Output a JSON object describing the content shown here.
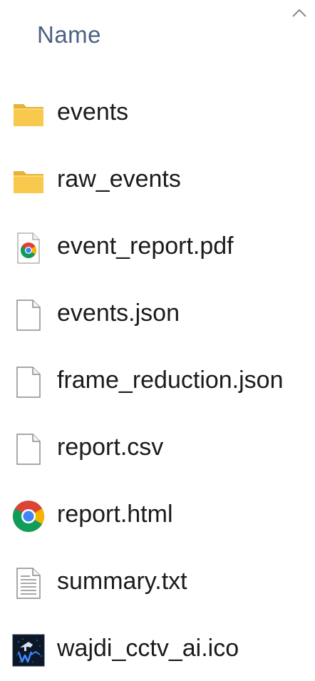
{
  "header": {
    "column_name": "Name",
    "sort_icon": "chevron-up-icon"
  },
  "files": [
    {
      "name": "events",
      "icon": "folder-icon",
      "slug": "events"
    },
    {
      "name": "raw_events",
      "icon": "folder-icon",
      "slug": "raw-events"
    },
    {
      "name": "event_report.pdf",
      "icon": "pdf-chrome-icon",
      "slug": "event-report-pdf"
    },
    {
      "name": "events.json",
      "icon": "generic-file-icon",
      "slug": "events-json"
    },
    {
      "name": "frame_reduction.json",
      "icon": "generic-file-icon",
      "slug": "frame-reduction-json"
    },
    {
      "name": "report.csv",
      "icon": "generic-file-icon",
      "slug": "report-csv"
    },
    {
      "name": "report.html",
      "icon": "chrome-icon",
      "slug": "report-html"
    },
    {
      "name": "summary.txt",
      "icon": "text-file-icon",
      "slug": "summary-txt"
    },
    {
      "name": "wajdi_cctv_ai.ico",
      "icon": "ico-image-icon",
      "slug": "wajdi-cctv-ai-ico"
    }
  ],
  "colors": {
    "header_text": "#4d6082",
    "folder": "#f8c94d",
    "chrome_red": "#db4437",
    "chrome_green": "#0f9d58",
    "chrome_yellow": "#f4b400",
    "chrome_blue": "#4285f4"
  }
}
